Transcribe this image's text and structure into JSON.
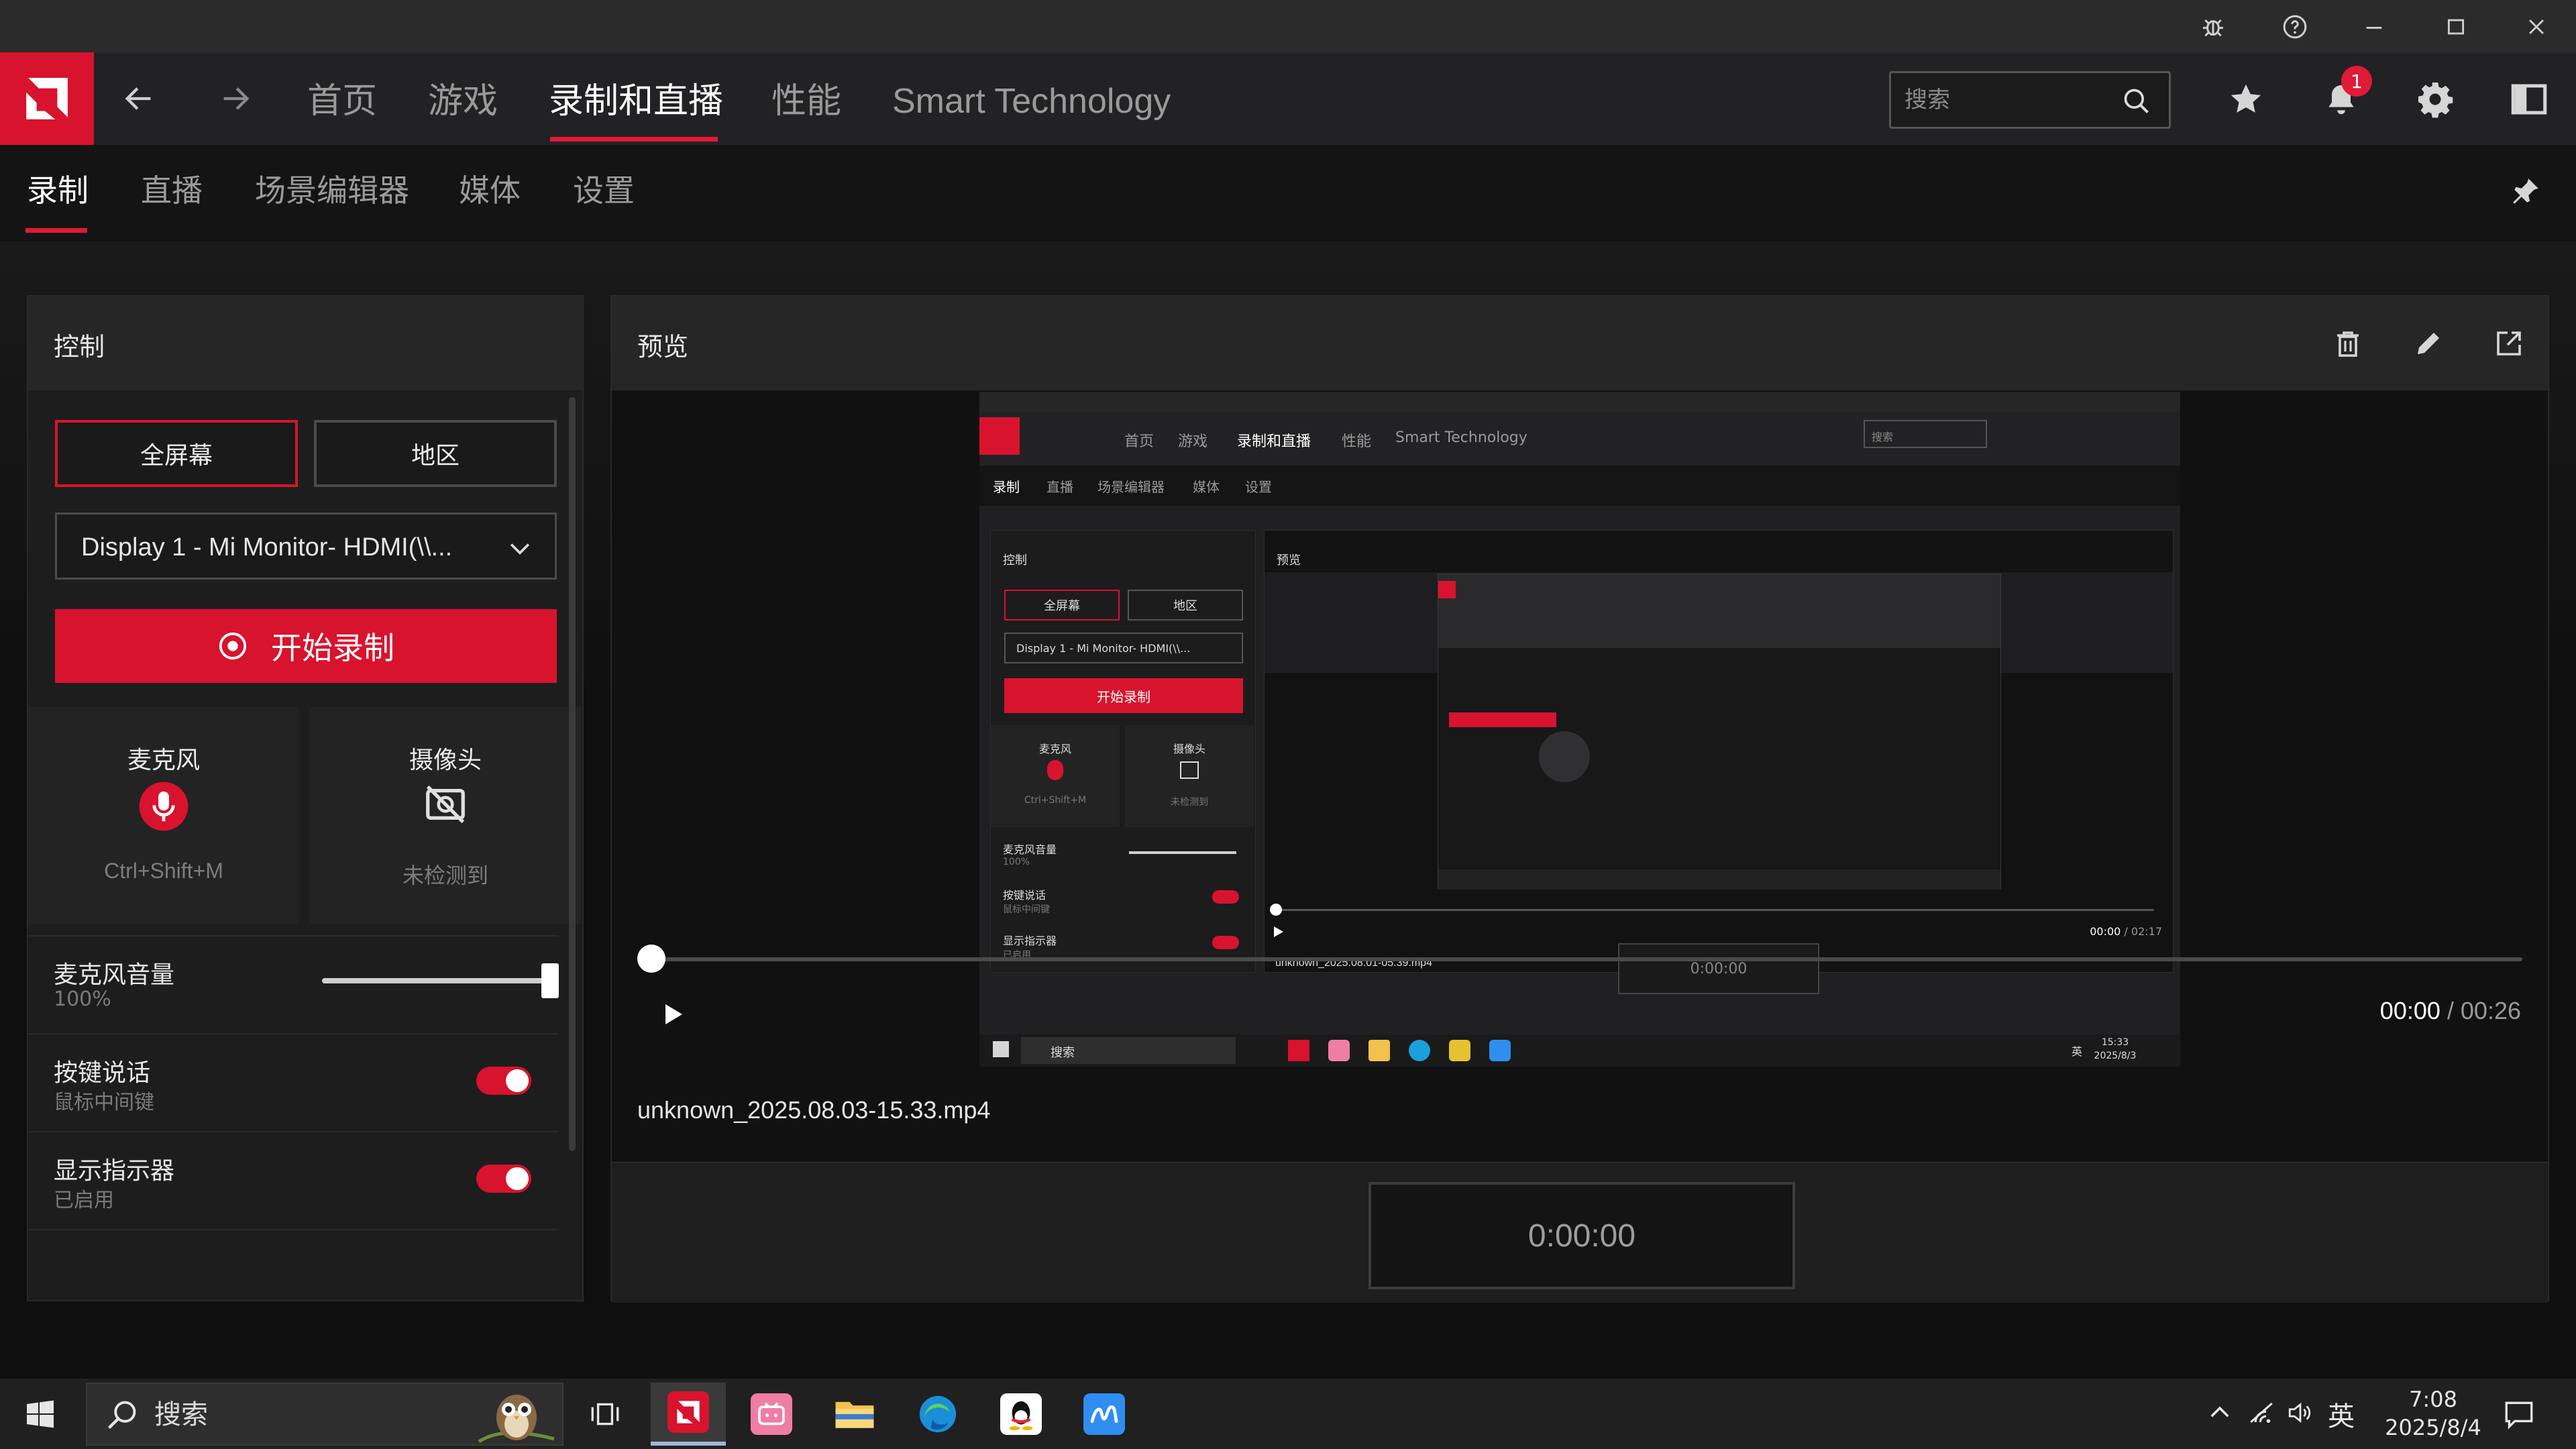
{
  "titlebar": {
    "icons": [
      "bug-icon",
      "help-icon",
      "minimize-icon",
      "maximize-icon",
      "close-icon"
    ]
  },
  "nav": {
    "tabs": [
      {
        "label": "首页"
      },
      {
        "label": "游戏"
      },
      {
        "label": "录制和直播"
      },
      {
        "label": "性能"
      },
      {
        "label": "Smart Technology"
      }
    ],
    "active_tab": "录制和直播",
    "search_placeholder": "搜索",
    "notification_count": "1",
    "accent_color": "#d8132e"
  },
  "subnav": {
    "tabs": [
      {
        "label": "录制"
      },
      {
        "label": "直播"
      },
      {
        "label": "场景编辑器"
      },
      {
        "label": "媒体"
      },
      {
        "label": "设置"
      }
    ],
    "active_tab": "录制"
  },
  "control": {
    "title": "控制",
    "mode_fullscreen": "全屏幕",
    "mode_region": "地区",
    "selected_mode": "全屏幕",
    "display_value": "Display 1 - Mi Monitor- HDMI(\\\\...",
    "record_label": "开始录制",
    "microphone": {
      "title": "麦克风",
      "sub": "Ctrl+Shift+M"
    },
    "camera": {
      "title": "摄像头",
      "sub": "未检测到"
    },
    "mic_volume": {
      "label": "麦克风音量",
      "value": "100%",
      "level": 1.0
    },
    "push_to_talk": {
      "label": "按键说话",
      "sub": "鼠标中间键",
      "on": true
    },
    "show_indicator": {
      "label": "显示指示器",
      "sub": "已启用",
      "on": true
    }
  },
  "preview": {
    "title": "预览",
    "current_time": "00:00",
    "separator": " / ",
    "total_time": "00:26",
    "filename": "unknown_2025.08.03-15.33.mp4",
    "timer": "0:00:00",
    "progress": 0.0,
    "mini": {
      "nav_labels": [
        "首页",
        "游戏",
        "录制和直播",
        "性能",
        "Smart Technology"
      ],
      "sub_labels": [
        "录制",
        "直播",
        "场景编辑器",
        "媒体",
        "设置"
      ],
      "search": "搜索",
      "control": "控制",
      "preview": "预览",
      "fullscreen": "全屏幕",
      "region": "地区",
      "display": "Display 1 - Mi Monitor- HDMI(\\\\...",
      "record": "开始录制",
      "mic": "麦克风",
      "mic_sub": "Ctrl+Shift+M",
      "cam": "摄像头",
      "cam_sub": "未检测到",
      "vol": "麦克风音量",
      "vol_sub": "100%",
      "ptt": "按键说话",
      "ptt_sub": "鼠标中间键",
      "ind": "显示指示器",
      "ind_sub": "已启用",
      "filename": "unknown_2025.08.01-05.39.mp4",
      "time_cur": "00:00",
      "time_sep": " / ",
      "time_tot": "02:17",
      "timer": "0:00:00",
      "taskbar_search": "搜索",
      "ime": "英",
      "clock_time": "15:33",
      "clock_date": "2025/8/3"
    }
  },
  "taskbar": {
    "search_placeholder": "搜索",
    "apps": [
      "amd-software-icon",
      "bilibili-icon",
      "file-explorer-icon",
      "edge-icon",
      "qq-icon",
      "maxhub-icon"
    ],
    "ime": "英",
    "time": "7:08",
    "date": "2025/8/4"
  }
}
